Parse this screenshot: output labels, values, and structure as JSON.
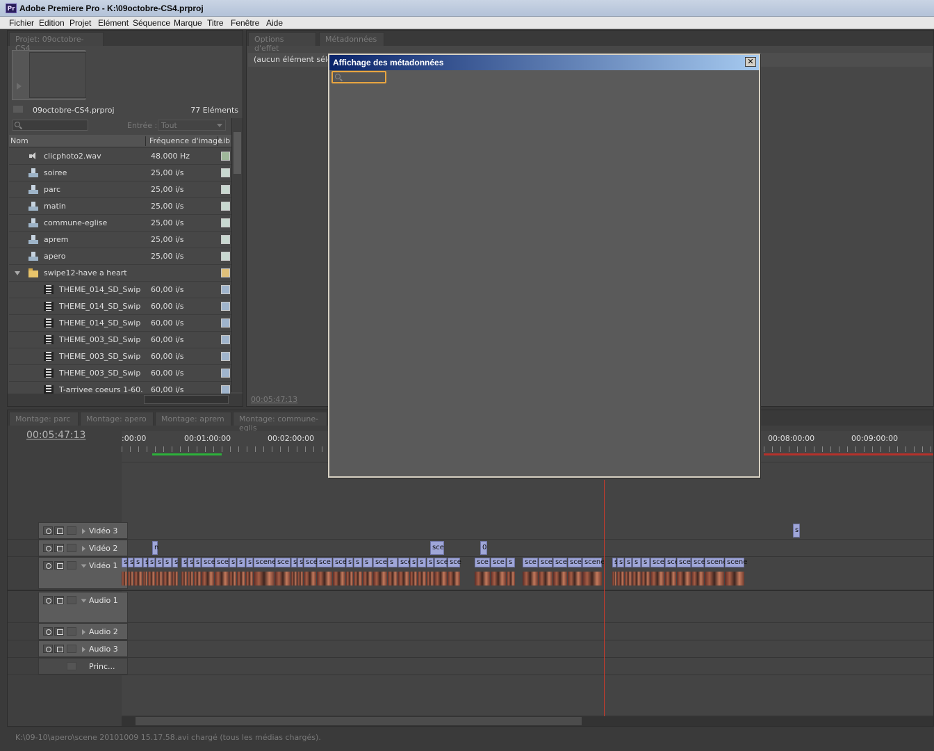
{
  "window": {
    "title": "Adobe Premiere Pro - K:\\09octobre-CS4.prproj",
    "icon_text": "Pr"
  },
  "menu": [
    "Fichier",
    "Edition",
    "Projet",
    "Elément",
    "Séquence",
    "Marque",
    "Titre",
    "Fenêtre",
    "Aide"
  ],
  "project_panel": {
    "tab": "Projet: 09octobre-CS4",
    "project_file": "09octobre-CS4.prproj",
    "item_count": "77 Eléments",
    "entry_label": "Entrée :",
    "entry_value": "Tout",
    "columns": {
      "name": "Nom",
      "rate": "Fréquence d'image",
      "lib": "Lib"
    },
    "items": [
      {
        "name": "clicphoto2.wav",
        "rate": "48.000 Hz",
        "icon": "audio",
        "color": "#9fb89a"
      },
      {
        "name": "soiree",
        "rate": "25,00 i/s",
        "icon": "sequence",
        "color": "#c8d8d0"
      },
      {
        "name": "parc",
        "rate": "25,00 i/s",
        "icon": "sequence",
        "color": "#c8d8d0"
      },
      {
        "name": "matin",
        "rate": "25,00 i/s",
        "icon": "sequence",
        "color": "#c8d8d0"
      },
      {
        "name": "commune-eglise",
        "rate": "25,00 i/s",
        "icon": "sequence",
        "color": "#c8d8d0"
      },
      {
        "name": "aprem",
        "rate": "25,00 i/s",
        "icon": "sequence",
        "color": "#c8d8d0"
      },
      {
        "name": "apero",
        "rate": "25,00 i/s",
        "icon": "sequence",
        "color": "#c8d8d0"
      },
      {
        "name": "swipe12-have a heart",
        "rate": "",
        "icon": "folder",
        "color": "#e0c07a"
      },
      {
        "name": "THEME_014_SD_Swip",
        "rate": "60,00 i/s",
        "icon": "film",
        "color": "#9fb4cc"
      },
      {
        "name": "THEME_014_SD_Swip",
        "rate": "60,00 i/s",
        "icon": "film",
        "color": "#9fb4cc"
      },
      {
        "name": "THEME_014_SD_Swip",
        "rate": "60,00 i/s",
        "icon": "film",
        "color": "#9fb4cc"
      },
      {
        "name": "THEME_003_SD_Swip",
        "rate": "60,00 i/s",
        "icon": "film",
        "color": "#9fb4cc"
      },
      {
        "name": "THEME_003_SD_Swip",
        "rate": "60,00 i/s",
        "icon": "film",
        "color": "#9fb4cc"
      },
      {
        "name": "THEME_003_SD_Swip",
        "rate": "60,00 i/s",
        "icon": "film",
        "color": "#9fb4cc"
      },
      {
        "name": "T-arrivee coeurs 1-60.",
        "rate": "60,00 i/s",
        "icon": "film",
        "color": "#9fb4cc"
      }
    ]
  },
  "effect_panel": {
    "tabs": [
      "Options d'effet",
      "Métadonnées"
    ],
    "no_selection": "(aucun élément sélec",
    "timecode": "00:05:47:13"
  },
  "timeline": {
    "tabs": [
      "Montage: parc",
      "Montage: apero",
      "Montage: aprem",
      "Montage: commune-eglis"
    ],
    "timecode": "00:05:47:13",
    "ruler": [
      ":00:00",
      "00:01:00:00",
      "00:02:00:00",
      "00:08:00:00",
      "00:09:00:00"
    ],
    "tracks": {
      "video3": "Vidéo 3",
      "video2": "Vidéo 2",
      "video1": "Vidéo 1",
      "audio1": "Audio 1",
      "audio2": "Audio 2",
      "audio3": "Audio 3",
      "master": "Princ..."
    },
    "clip_labels": [
      "s",
      "sce",
      "scene",
      "scen",
      "0",
      "n"
    ]
  },
  "metadata_dialog": {
    "title": "Affichage des métadonnées",
    "close": "✕"
  },
  "status": "K:\\09-10\\apero\\scene 20101009 15.17.58.avi chargé (tous les médias chargés)."
}
